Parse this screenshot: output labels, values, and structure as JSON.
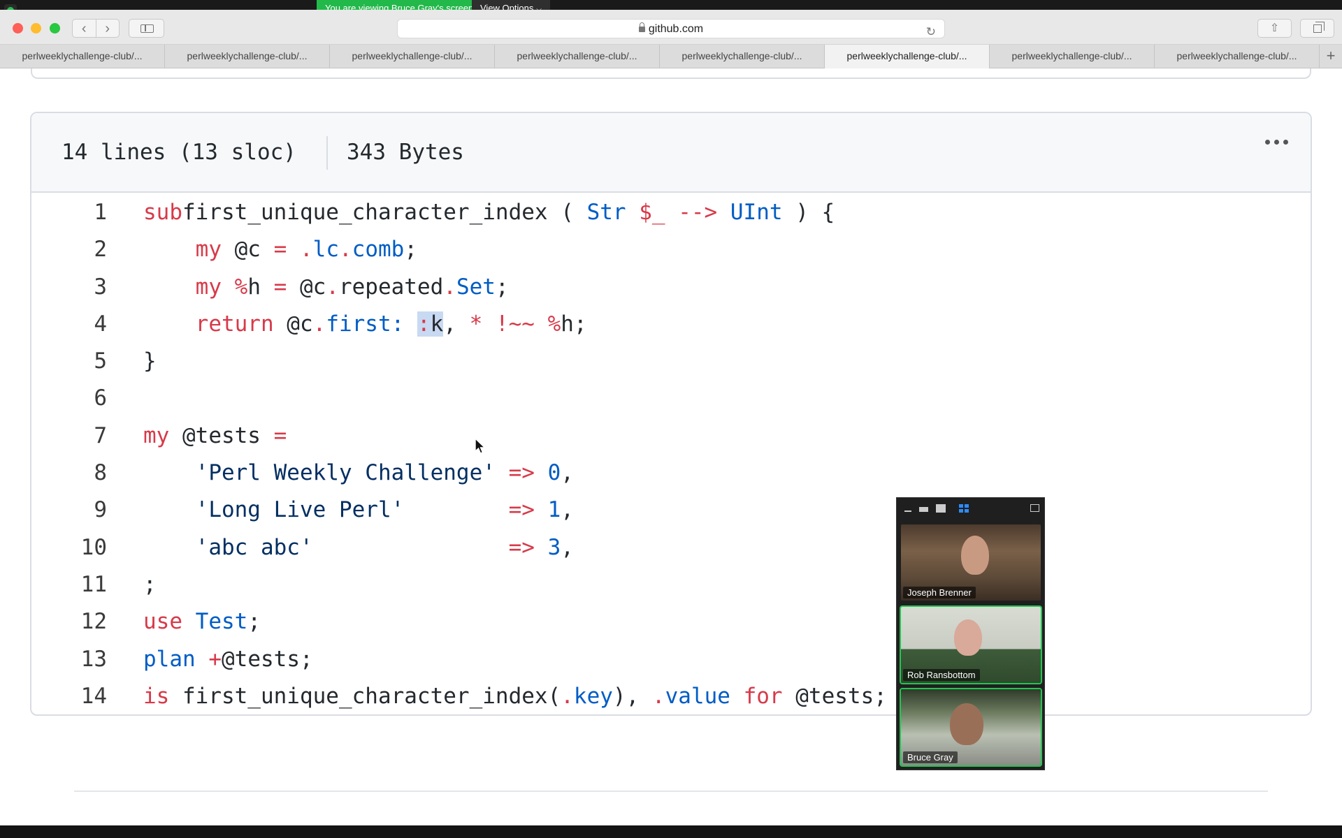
{
  "share_banner": {
    "viewing_text": "You are viewing Bruce Gray's screen",
    "view_options_label": "View Options"
  },
  "browser": {
    "address": "github.com",
    "tabs": [
      {
        "label": "perlweeklychallenge-club/...",
        "active": false
      },
      {
        "label": "perlweeklychallenge-club/...",
        "active": false
      },
      {
        "label": "perlweeklychallenge-club/...",
        "active": false
      },
      {
        "label": "perlweeklychallenge-club/...",
        "active": false
      },
      {
        "label": "perlweeklychallenge-club/...",
        "active": false
      },
      {
        "label": "perlweeklychallenge-club/...",
        "active": true
      },
      {
        "label": "perlweeklychallenge-club/...",
        "active": false
      },
      {
        "label": "perlweeklychallenge-club/...",
        "active": false
      }
    ],
    "new_tab_label": "+"
  },
  "file": {
    "lines_info": "14 lines (13 sloc)",
    "size_info": "343 Bytes",
    "code_lines": [
      {
        "num": "1",
        "tokens": [
          [
            "kw",
            "sub"
          ],
          [
            "",
            "first_unique_character_index ( "
          ],
          [
            "tp",
            "Str"
          ],
          [
            "kw",
            " $_ --> "
          ],
          [
            "tp",
            "UInt"
          ],
          [
            "",
            " ) {"
          ]
        ]
      },
      {
        "num": "2",
        "tokens": [
          [
            "",
            "    "
          ],
          [
            "kw",
            "my"
          ],
          [
            "",
            " @c "
          ],
          [
            "kw",
            "="
          ],
          [
            "",
            " "
          ],
          [
            "kw",
            "."
          ],
          [
            "tp",
            "lc"
          ],
          [
            "kw",
            "."
          ],
          [
            "tp",
            "comb"
          ],
          [
            "",
            ";"
          ]
        ]
      },
      {
        "num": "3",
        "tokens": [
          [
            "",
            "    "
          ],
          [
            "kw",
            "my"
          ],
          [
            "kw",
            " %"
          ],
          [
            "",
            "h "
          ],
          [
            "kw",
            "="
          ],
          [
            "",
            " @c"
          ],
          [
            "kw",
            "."
          ],
          [
            "",
            "repeated"
          ],
          [
            "kw",
            "."
          ],
          [
            "tp",
            "Set"
          ],
          [
            "",
            ";"
          ]
        ]
      },
      {
        "num": "4",
        "tokens": [
          [
            "",
            "    "
          ],
          [
            "kw",
            "return"
          ],
          [
            "",
            " @c"
          ],
          [
            "kw",
            "."
          ],
          [
            "tp",
            "first:"
          ],
          [
            "",
            " "
          ],
          [
            "kwhl",
            ":"
          ],
          [
            "hl",
            "k"
          ],
          [
            "",
            ", "
          ],
          [
            "kw",
            "* !~~ %"
          ],
          [
            "",
            "h;"
          ]
        ]
      },
      {
        "num": "5",
        "tokens": [
          [
            "",
            "}"
          ]
        ]
      },
      {
        "num": "6",
        "tokens": []
      },
      {
        "num": "7",
        "tokens": [
          [
            "kw",
            "my"
          ],
          [
            "",
            " @tests "
          ],
          [
            "kw",
            "="
          ]
        ]
      },
      {
        "num": "8",
        "tokens": [
          [
            "",
            "    "
          ],
          [
            "st",
            "'Perl Weekly Challenge'"
          ],
          [
            "kw",
            " => "
          ],
          [
            "tp",
            "0"
          ],
          [
            "",
            ","
          ]
        ]
      },
      {
        "num": "9",
        "tokens": [
          [
            "",
            "    "
          ],
          [
            "st",
            "'Long Live Perl'"
          ],
          [
            "",
            "        "
          ],
          [
            "kw",
            "=> "
          ],
          [
            "tp",
            "1"
          ],
          [
            "",
            ","
          ]
        ]
      },
      {
        "num": "10",
        "tokens": [
          [
            "",
            "    "
          ],
          [
            "st",
            "'abc abc'"
          ],
          [
            "",
            "               "
          ],
          [
            "kw",
            "=> "
          ],
          [
            "tp",
            "3"
          ],
          [
            "",
            ","
          ]
        ]
      },
      {
        "num": "11",
        "tokens": [
          [
            "",
            ";"
          ]
        ]
      },
      {
        "num": "12",
        "tokens": [
          [
            "kw",
            "use"
          ],
          [
            "",
            " "
          ],
          [
            "tp",
            "Test"
          ],
          [
            "",
            ";"
          ]
        ]
      },
      {
        "num": "13",
        "tokens": [
          [
            "tp",
            "plan"
          ],
          [
            "",
            " "
          ],
          [
            "kw",
            "+"
          ],
          [
            "",
            "@tests;"
          ]
        ]
      },
      {
        "num": "14",
        "tokens": [
          [
            "kw",
            "is"
          ],
          [
            "",
            " first_unique_character_index("
          ],
          [
            "kw",
            "."
          ],
          [
            "tp",
            "key"
          ],
          [
            "",
            "), "
          ],
          [
            "kw",
            "."
          ],
          [
            "tp",
            "value"
          ],
          [
            "",
            " "
          ],
          [
            "kw",
            "for"
          ],
          [
            "",
            " @tests;"
          ]
        ]
      }
    ]
  },
  "video_panel": {
    "participants": [
      {
        "name": "Joseph Brenner"
      },
      {
        "name": "Rob Ransbottom"
      },
      {
        "name": "Bruce Gray"
      }
    ]
  }
}
